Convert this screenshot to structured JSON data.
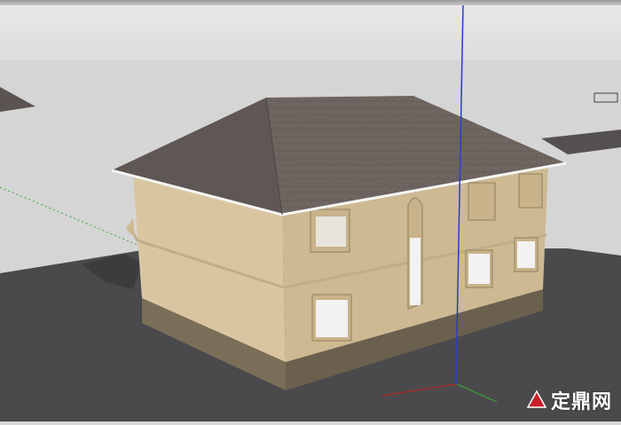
{
  "scene": {
    "sky_color": "#e6e6e6",
    "horizon_color": "#cfcfcf",
    "ground_color": "#4a4a4c",
    "wall_color": "#d9c6a1",
    "wall_shadow_color": "#cdb992",
    "roof_color": "#6f6561",
    "base_color": "#7a6e58",
    "glass_color": "#f2f2f2"
  },
  "axes": {
    "blue_axis": "#2b3cc8",
    "red_axis": "#c81e1e",
    "green_axis": "#3aa83a"
  },
  "watermark": {
    "text": "定鼎网"
  }
}
